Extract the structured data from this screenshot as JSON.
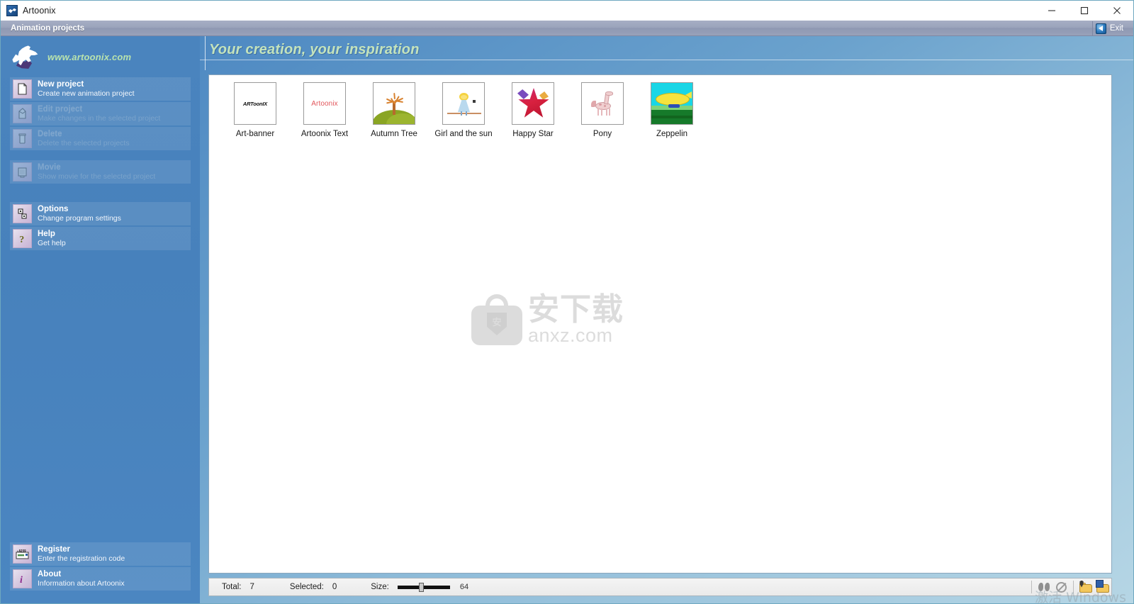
{
  "window": {
    "title": "Artoonix",
    "app_icon": "artoonix-logo-icon",
    "minimize_label": "Minimize",
    "maximize_label": "Maximize",
    "close_label": "Close"
  },
  "menu_bar": {
    "section_title": "Animation projects",
    "exit_label": "Exit",
    "exit_icon": "exit-arrow-icon"
  },
  "sidebar": {
    "brand_url": "www.artoonix.com",
    "brand_logo_icon": "pegasus-logo-icon",
    "items": [
      {
        "title": "New project",
        "subtitle": "Create new animation project",
        "icon": "new-document-icon",
        "disabled": false
      },
      {
        "title": "Edit project",
        "subtitle": "Make changes in the selected project",
        "icon": "pencil-edit-icon",
        "disabled": true
      },
      {
        "title": "Delete",
        "subtitle": "Delete the selected projects",
        "icon": "trash-can-icon",
        "disabled": true
      },
      {
        "title": "Movie",
        "subtitle": "Show movie for the selected project",
        "icon": "film-movie-icon",
        "disabled": true
      },
      {
        "title": "Options",
        "subtitle": "Change program settings",
        "icon": "gear-options-icon",
        "disabled": false
      },
      {
        "title": "Help",
        "subtitle": "Get help",
        "icon": "question-mark-icon",
        "disabled": false
      }
    ],
    "bottom_items": [
      {
        "title": "Register",
        "subtitle": "Enter the registration code",
        "icon": "registration-code-icon"
      },
      {
        "title": "About",
        "subtitle": "Information about Artoonix",
        "icon": "info-about-icon"
      }
    ]
  },
  "main": {
    "banner_title": "Your creation, your inspiration",
    "projects": [
      {
        "label": "Art-banner",
        "thumb": "art-banner-thumbnail",
        "thumb_text": "ARToonIX"
      },
      {
        "label": "Artoonix Text",
        "thumb": "artoonix-text-thumbnail",
        "thumb_text": "Artoonix"
      },
      {
        "label": "Autumn Tree",
        "thumb": "autumn-tree-thumbnail",
        "thumb_text": ""
      },
      {
        "label": "Girl and the sun",
        "thumb": "girl-and-sun-thumbnail",
        "thumb_text": ""
      },
      {
        "label": "Happy Star",
        "thumb": "happy-star-thumbnail",
        "thumb_text": ""
      },
      {
        "label": "Pony",
        "thumb": "pony-thumbnail",
        "thumb_text": ""
      },
      {
        "label": "Zeppelin",
        "thumb": "zeppelin-thumbnail",
        "thumb_text": ""
      }
    ],
    "watermark": {
      "cn": "安下载",
      "en": "anxz.com",
      "shield_char": "安"
    }
  },
  "status_bar": {
    "total_label": "Total:",
    "total_value": "7",
    "selected_label": "Selected:",
    "selected_value": "0",
    "size_label": "Size:",
    "size_value": "64",
    "icons": [
      {
        "name": "butterfly-icon"
      },
      {
        "name": "no-entry-icon"
      },
      {
        "name": "open-folder-icon"
      },
      {
        "name": "open-folder-blue-icon"
      }
    ]
  },
  "os_watermark": "激活 Windows",
  "colors": {
    "sidebar_blue": "#4a84be",
    "banner_green": "#c4e3bc",
    "menu_gray": "#9aa3bb",
    "accent_link": "#b8e3ae"
  }
}
